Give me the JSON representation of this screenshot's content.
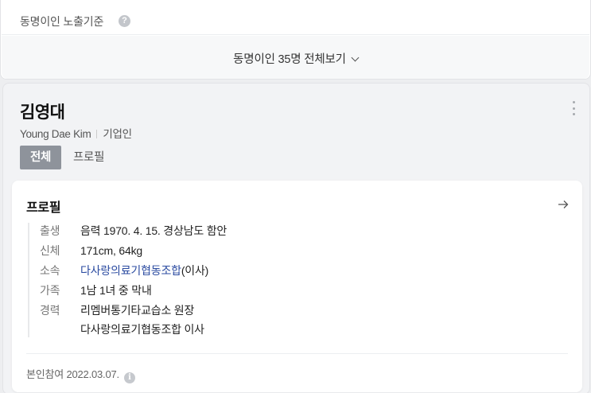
{
  "criteria": {
    "label": "동명이인 노출기준",
    "help_icon": "question-circle-icon"
  },
  "more": {
    "label": "동명이인 35명 전체보기",
    "icon": "chevron-down-icon"
  },
  "person": {
    "name": "김영대",
    "english_name": "Young Dae Kim",
    "occupation": "기업인",
    "menu_icon": "kebab-menu-icon",
    "tabs": [
      {
        "label": "전체",
        "active": true
      },
      {
        "label": "프로필",
        "active": false
      }
    ],
    "profile": {
      "title": "프로필",
      "arrow_icon": "arrow-right-icon",
      "rows": [
        {
          "key": "출생",
          "value": "음력 1970. 4. 15. 경상남도 함안"
        },
        {
          "key": "신체",
          "value": "171cm, 64kg"
        },
        {
          "key": "소속",
          "link": "다사랑의료기협동조합",
          "suffix": "(이사)"
        },
        {
          "key": "가족",
          "value": "1남 1녀 중 막내"
        },
        {
          "key": "경력",
          "value": "리멤버통기타교습소 원장",
          "value2": "다사랑의료기협동조합 이사"
        }
      ],
      "footer": "본인참여 2022.03.07.",
      "footer_icon": "info-icon"
    }
  },
  "colors": {
    "link": "#2a4aa0",
    "tab_active_bg": "#8e939b",
    "page_bg": "#edeef0"
  }
}
